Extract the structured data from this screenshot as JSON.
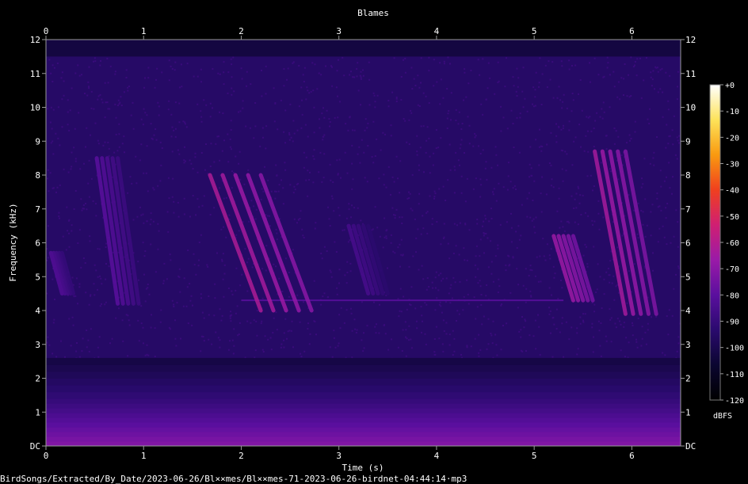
{
  "chart_data": {
    "type": "heatmap",
    "title": "Blames",
    "xlabel": "Time (s)",
    "ylabel": "Frequency (kHz)",
    "x_ticks": [
      "0",
      "1",
      "2",
      "3",
      "4",
      "5",
      "6"
    ],
    "y_ticks": [
      "DC",
      "1",
      "2",
      "3",
      "4",
      "5",
      "6",
      "7",
      "8",
      "9",
      "10",
      "11",
      "12"
    ],
    "xlim": [
      0,
      6.5
    ],
    "ylim": [
      0,
      12
    ],
    "colorbar": {
      "label": "dBFS",
      "ticks": [
        "+0",
        "-10",
        "-20",
        "-30",
        "-40",
        "-50",
        "-60",
        "-70",
        "-80",
        "-90",
        "-100",
        "-110",
        "-120"
      ],
      "range": [
        -120,
        0
      ],
      "colors": [
        "#000000",
        "#0b0630",
        "#2a0a6e",
        "#5a0f9e",
        "#9a1aa8",
        "#d01f72",
        "#f0401e",
        "#f99a10",
        "#fde35a",
        "#ffffff"
      ]
    },
    "background_level_dbfs": -95,
    "low_band": {
      "from_khz": 0,
      "to_khz": 1.4,
      "level_dbfs": -72
    },
    "calls": [
      {
        "t_start": 0.05,
        "t_end": 0.28,
        "f_start": 5.7,
        "f_end": 4.5,
        "level_dbfs": -82
      },
      {
        "t_start": 0.52,
        "t_end": 0.95,
        "f_start": 8.5,
        "f_end": 4.2,
        "level_dbfs": -80
      },
      {
        "t_start": 1.68,
        "t_end": 2.72,
        "f_start": 8.0,
        "f_end": 4.0,
        "level_dbfs": -62
      },
      {
        "t_start": 3.1,
        "t_end": 3.5,
        "f_start": 6.5,
        "f_end": 4.5,
        "level_dbfs": -85
      },
      {
        "t_start": 5.2,
        "t_end": 5.6,
        "f_start": 6.2,
        "f_end": 4.3,
        "level_dbfs": -66
      },
      {
        "t_start": 5.62,
        "t_end": 6.25,
        "f_start": 8.7,
        "f_end": 3.9,
        "level_dbfs": -64
      }
    ],
    "tone_lines": [
      {
        "t_start": 2.0,
        "t_end": 5.3,
        "f": 4.3,
        "level_dbfs": -82
      }
    ]
  },
  "footer": {
    "path": "BirdSongs/Extracted/By_Date/2023-06-26/Bl××mes/Bl××mes-71-2023-06-26-birdnet-04:44:14·mp3"
  }
}
